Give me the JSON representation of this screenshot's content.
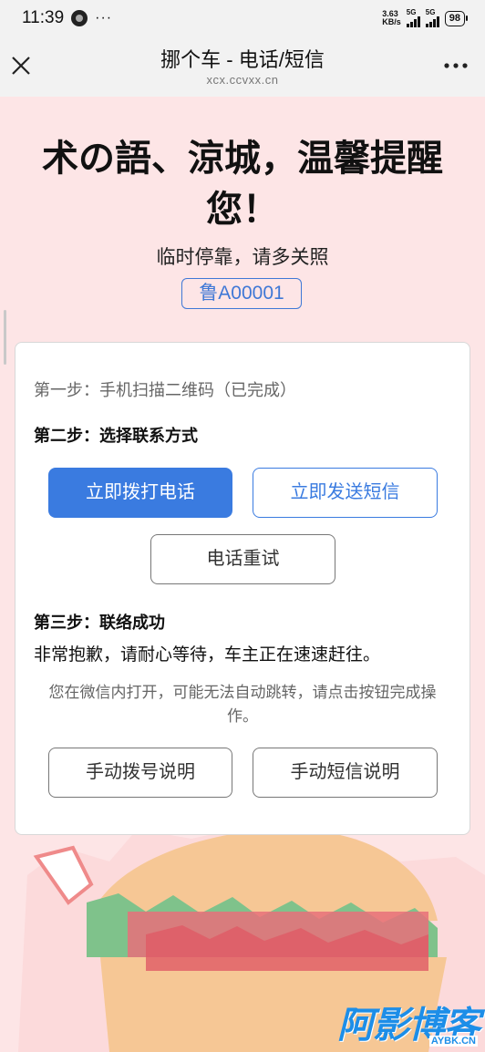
{
  "status_bar": {
    "time": "11:39",
    "dots": "···",
    "net_speed_value": "3.63",
    "net_speed_unit": "KB/s",
    "sim1_label": "5G",
    "sim2_label": "5G",
    "battery": "98"
  },
  "header": {
    "title": "挪个车 - 电话/短信",
    "url": "xcx.ccvxx.cn"
  },
  "greeting": "术の語、涼城，温馨提醒您！",
  "subtitle": "临时停靠，请多关照",
  "plate_number": "鲁A00001",
  "card": {
    "step1": "第一步：手机扫描二维码（已完成）",
    "step2": "第二步：选择联系方式",
    "call_button": "立即拨打电话",
    "sms_button": "立即发送短信",
    "retry_button": "电话重试",
    "step3": "第三步：联络成功",
    "apology": "非常抱歉，请耐心等待，车主正在速速赶往。",
    "wechat_note": "您在微信内打开，可能无法自动跳转，请点击按钮完成操作。",
    "dial_guide_button": "手动拨号说明",
    "sms_guide_button": "手动短信说明"
  },
  "watermark": {
    "main": "阿影博客",
    "sub": "AYBK.CN"
  },
  "colors": {
    "page_background": "#fde5e6",
    "accent": "#3a7be0"
  },
  "icons": {
    "close": "close-icon",
    "more": "more-icon"
  }
}
